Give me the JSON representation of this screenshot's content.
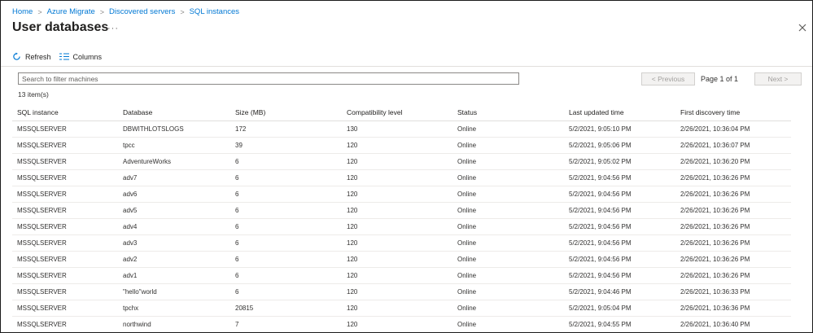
{
  "breadcrumb": [
    "Home",
    "Azure Migrate",
    "Discovered servers",
    "SQL instances"
  ],
  "page_title": "User databases",
  "more_label": "···",
  "toolbar": {
    "refresh_label": "Refresh",
    "columns_label": "Columns"
  },
  "search": {
    "placeholder": "Search to filter machines",
    "value": ""
  },
  "pager": {
    "previous_label": "< Previous",
    "page_label": "Page 1 of 1",
    "next_label": "Next >"
  },
  "item_count": "13 item(s)",
  "table": {
    "columns": [
      "SQL instance",
      "Database",
      "Size (MB)",
      "Compatibility level",
      "Status",
      "Last updated time",
      "First discovery time"
    ],
    "rows": [
      [
        "MSSQLSERVER",
        "DBWITHLOTSLOGS",
        "172",
        "130",
        "Online",
        "5/2/2021, 9:05:10 PM",
        "2/26/2021, 10:36:04 PM"
      ],
      [
        "MSSQLSERVER",
        "tpcc",
        "39",
        "120",
        "Online",
        "5/2/2021, 9:05:06 PM",
        "2/26/2021, 10:36:07 PM"
      ],
      [
        "MSSQLSERVER",
        "AdventureWorks",
        "6",
        "120",
        "Online",
        "5/2/2021, 9:05:02 PM",
        "2/26/2021, 10:36:20 PM"
      ],
      [
        "MSSQLSERVER",
        "adv7",
        "6",
        "120",
        "Online",
        "5/2/2021, 9:04:56 PM",
        "2/26/2021, 10:36:26 PM"
      ],
      [
        "MSSQLSERVER",
        "adv6",
        "6",
        "120",
        "Online",
        "5/2/2021, 9:04:56 PM",
        "2/26/2021, 10:36:26 PM"
      ],
      [
        "MSSQLSERVER",
        "adv5",
        "6",
        "120",
        "Online",
        "5/2/2021, 9:04:56 PM",
        "2/26/2021, 10:36:26 PM"
      ],
      [
        "MSSQLSERVER",
        "adv4",
        "6",
        "120",
        "Online",
        "5/2/2021, 9:04:56 PM",
        "2/26/2021, 10:36:26 PM"
      ],
      [
        "MSSQLSERVER",
        "adv3",
        "6",
        "120",
        "Online",
        "5/2/2021, 9:04:56 PM",
        "2/26/2021, 10:36:26 PM"
      ],
      [
        "MSSQLSERVER",
        "adv2",
        "6",
        "120",
        "Online",
        "5/2/2021, 9:04:56 PM",
        "2/26/2021, 10:36:26 PM"
      ],
      [
        "MSSQLSERVER",
        "adv1",
        "6",
        "120",
        "Online",
        "5/2/2021, 9:04:56 PM",
        "2/26/2021, 10:36:26 PM"
      ],
      [
        "MSSQLSERVER",
        "\"hello\"world",
        "6",
        "120",
        "Online",
        "5/2/2021, 9:04:46 PM",
        "2/26/2021, 10:36:33 PM"
      ],
      [
        "MSSQLSERVER",
        "tpchx",
        "20815",
        "120",
        "Online",
        "5/2/2021, 9:05:04 PM",
        "2/26/2021, 10:36:36 PM"
      ],
      [
        "MSSQLSERVER",
        "northwind",
        "7",
        "120",
        "Online",
        "5/2/2021, 9:04:55 PM",
        "2/26/2021, 10:36:40 PM"
      ]
    ]
  },
  "colors": {
    "link": "#0078d4",
    "border": "#e1dfdd",
    "text": "#201f1e"
  }
}
